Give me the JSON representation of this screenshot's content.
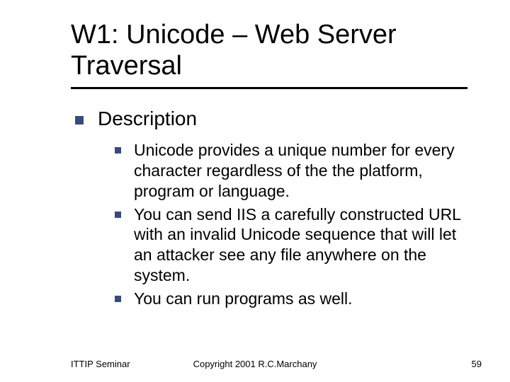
{
  "title": "W1: Unicode – Web Server Traversal",
  "section": "Description",
  "bullets": [
    "Unicode provides a unique number for every character regardless of the the platform, program or language.",
    "You can send IIS a carefully constructed URL with an invalid Unicode sequence that will let an attacker see any file anywhere on the system.",
    "You can run programs as well."
  ],
  "footer": {
    "left": "ITTIP Seminar",
    "center": "Copyright 2001 R.C.Marchany",
    "right": "59"
  }
}
